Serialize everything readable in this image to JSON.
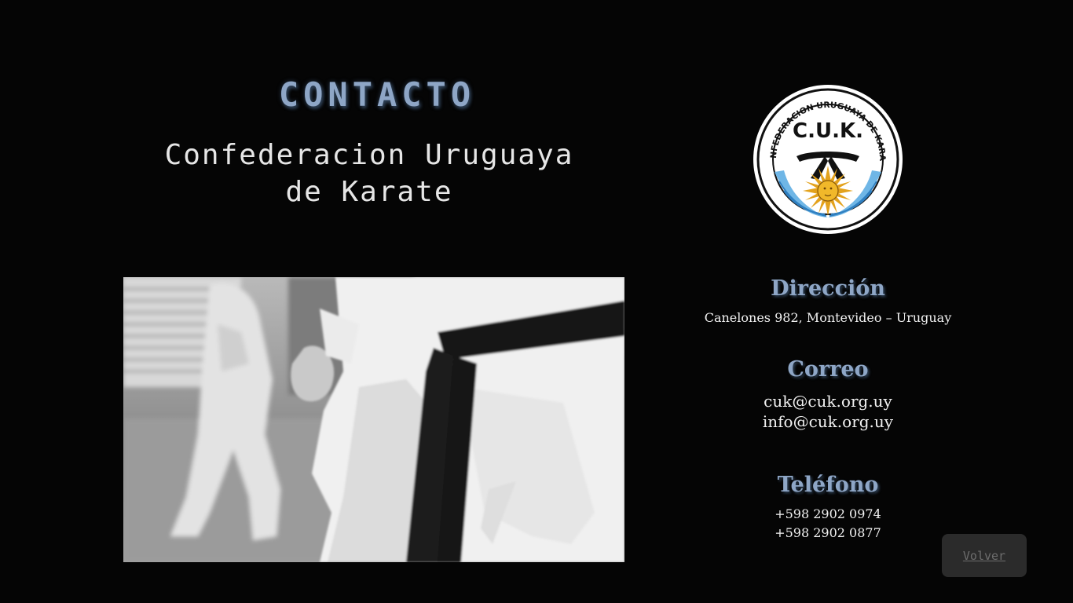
{
  "header": {
    "title": "CONTACTO",
    "org_line1": "Confederacion Uruguaya",
    "org_line2": "de Karate"
  },
  "logo": {
    "ring_text": "CONFEDERACION URUGUAYA DE KARATE",
    "initials": "C.U.K."
  },
  "address": {
    "title": "Dirección",
    "value": "Canelones 982, Montevideo – Uruguay"
  },
  "email": {
    "title": "Correo",
    "values": [
      "cuk@cuk.org.uy",
      "info@cuk.org.uy"
    ]
  },
  "phone": {
    "title": "Teléfono",
    "values": [
      "+598 2902 0974",
      "+598 2902 0877"
    ]
  },
  "back_button": {
    "label": "Volver"
  },
  "colors": {
    "background": "#050505",
    "accent": "#8ea6c6",
    "text": "#f2f2f2",
    "button_bg": "#2b2b2b"
  }
}
